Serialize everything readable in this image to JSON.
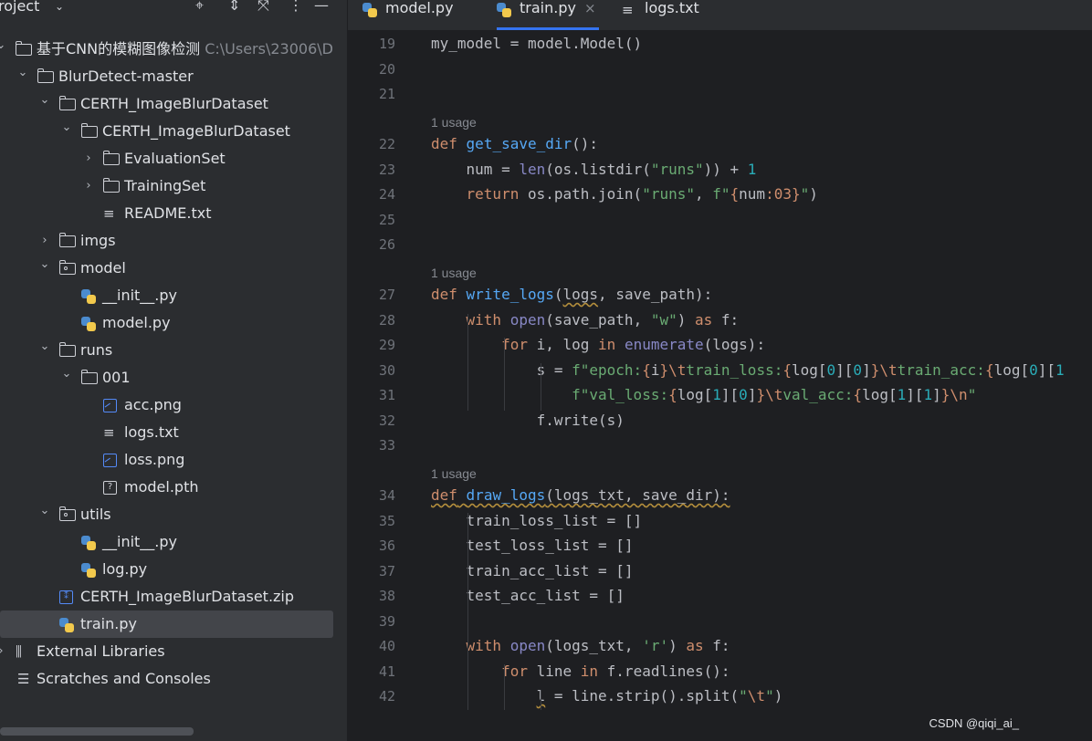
{
  "project_panel": {
    "title": "roject",
    "header_icons": [
      "crosshair-icon",
      "expand-collapse-icon",
      "collapse-all-icon",
      "more-icon",
      "minimize-icon"
    ]
  },
  "tree": [
    {
      "depth": 0,
      "type": "folder",
      "chev": "down",
      "label": "基于CNN的模糊图像检测",
      "hint": "C:\\Users\\23006\\D"
    },
    {
      "depth": 1,
      "type": "folder",
      "chev": "down",
      "label": "BlurDetect-master"
    },
    {
      "depth": 2,
      "type": "folder",
      "chev": "down",
      "label": "CERTH_ImageBlurDataset"
    },
    {
      "depth": 3,
      "type": "folder",
      "chev": "down",
      "label": "CERTH_ImageBlurDataset"
    },
    {
      "depth": 4,
      "type": "folder",
      "chev": "right",
      "label": "EvaluationSet"
    },
    {
      "depth": 4,
      "type": "folder",
      "chev": "right",
      "label": "TrainingSet"
    },
    {
      "depth": 4,
      "type": "text",
      "label": "README.txt"
    },
    {
      "depth": 2,
      "type": "folder",
      "chev": "right",
      "label": "imgs"
    },
    {
      "depth": 2,
      "type": "package",
      "chev": "down",
      "label": "model"
    },
    {
      "depth": 3,
      "type": "python",
      "label": "__init__.py"
    },
    {
      "depth": 3,
      "type": "python",
      "label": "model.py"
    },
    {
      "depth": 2,
      "type": "folder",
      "chev": "down",
      "label": "runs"
    },
    {
      "depth": 3,
      "type": "folder",
      "chev": "down",
      "label": "001"
    },
    {
      "depth": 4,
      "type": "image",
      "label": "acc.png"
    },
    {
      "depth": 4,
      "type": "text",
      "label": "logs.txt"
    },
    {
      "depth": 4,
      "type": "image",
      "label": "loss.png"
    },
    {
      "depth": 4,
      "type": "unknown",
      "label": "model.pth"
    },
    {
      "depth": 2,
      "type": "package",
      "chev": "down",
      "label": "utils"
    },
    {
      "depth": 3,
      "type": "python",
      "label": "__init__.py"
    },
    {
      "depth": 3,
      "type": "python",
      "label": "log.py"
    },
    {
      "depth": 2,
      "type": "zip",
      "label": "CERTH_ImageBlurDataset.zip"
    },
    {
      "depth": 2,
      "type": "python",
      "label": "train.py",
      "selected": true
    },
    {
      "depth": 0,
      "type": "library",
      "chev": "right",
      "label": "External Libraries"
    },
    {
      "depth": 0,
      "type": "scratch",
      "label": "Scratches and Consoles"
    }
  ],
  "tabs": [
    {
      "label": "model.py",
      "icon": "python-icon"
    },
    {
      "label": "train.py",
      "icon": "python-icon",
      "active": true,
      "close": "×"
    },
    {
      "label": "logs.txt",
      "icon": "text-file-icon"
    }
  ],
  "code": [
    {
      "n": "19",
      "html": "my_model = model.Model()"
    },
    {
      "n": "20",
      "html": ""
    },
    {
      "n": "21",
      "html": ""
    },
    {
      "usage": "1 usage"
    },
    {
      "n": "22",
      "html": "<span class='kw'>def</span> <span class='fn'>get_save_dir</span>():"
    },
    {
      "n": "23",
      "html": "    num = <span class='bi'>len</span>(os.listdir(<span class='st'>\"runs\"</span>)) + <span class='nm'>1</span>"
    },
    {
      "n": "24",
      "html": "    <span class='kw'>return</span> os.path.join(<span class='st'>\"runs\"</span>, <span class='st'>f\"</span><span class='fb'>{</span>num<span class='fb'>:03}</span><span class='st'>\"</span>)"
    },
    {
      "n": "25",
      "html": ""
    },
    {
      "n": "26",
      "html": ""
    },
    {
      "usage": "1 usage"
    },
    {
      "n": "27",
      "html": "<span class='kw'>def</span> <span class='fn'>write_logs</span>(<span class='sq'>logs</span>, save_path):"
    },
    {
      "n": "28",
      "html": "    <span class='kw'>with</span> <span class='bi'>open</span>(save_path, <span class='st'>\"w\"</span>) <span class='kw'>as</span> f:"
    },
    {
      "n": "29",
      "html": "        <span class='kw'>for</span> i, log <span class='kw'>in</span> <span class='bi'>enumerate</span>(logs):"
    },
    {
      "n": "30",
      "html": "            s = <span class='st'>f\"epoch:</span><span class='fb'>{</span>i<span class='fb'>}</span><span class='esc'>\\t</span><span class='st'>train_loss:</span><span class='fb'>{</span>log[<span class='nm'>0</span>][<span class='nm'>0</span>]<span class='fb'>}</span><span class='esc'>\\t</span><span class='st'>train_acc:</span><span class='fb'>{</span>log[<span class='nm'>0</span>][<span class='nm'>1</span>"
    },
    {
      "n": "31",
      "html": "                <span class='st'>f\"val_loss:</span><span class='fb'>{</span>log[<span class='nm'>1</span>][<span class='nm'>0</span>]<span class='fb'>}</span><span class='esc'>\\t</span><span class='st'>val_acc:</span><span class='fb'>{</span>log[<span class='nm'>1</span>][<span class='nm'>1</span>]<span class='fb'>}</span><span class='esc'>\\n</span><span class='st'>\"</span>"
    },
    {
      "n": "32",
      "html": "            f.write(s)"
    },
    {
      "n": "33",
      "html": ""
    },
    {
      "usage": "1 usage"
    },
    {
      "n": "34",
      "html": "<span class='kw sq'>def</span><span class='sq'> </span><span class='fn sq'>draw_logs</span><span class='sq'>(logs_txt, save_dir):</span>"
    },
    {
      "n": "35",
      "html": "    train_loss_list = []"
    },
    {
      "n": "36",
      "html": "    test_loss_list = []"
    },
    {
      "n": "37",
      "html": "    train_acc_list = []"
    },
    {
      "n": "38",
      "html": "    test_acc_list = []"
    },
    {
      "n": "39",
      "html": ""
    },
    {
      "n": "40",
      "html": "    <span class='kw'>with</span> <span class='bi'>open</span>(logs_txt, <span class='st'>'r'</span>) <span class='kw'>as</span> f:"
    },
    {
      "n": "41",
      "html": "        <span class='kw'>for</span> line <span class='kw'>in</span> f.readlines():"
    },
    {
      "n": "42",
      "html": "            <span class='sq'>l</span> = line.strip().split(<span class='st'>\"</span><span class='esc'>\\t</span><span class='st'>\"</span>)"
    }
  ],
  "watermark": "CSDN @qiqi_ai_"
}
